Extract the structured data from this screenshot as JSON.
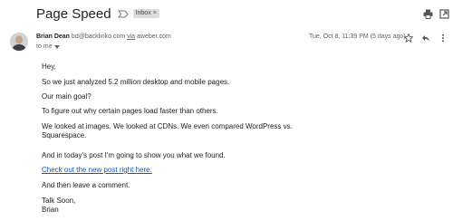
{
  "email": {
    "subject": "Page Speed",
    "label_chip": "Inbox",
    "chip_close": "×",
    "sender": {
      "name": "Brian Dean",
      "email": "bd@backlinko.com",
      "via_text": "via",
      "via_domain": "aweber.com",
      "to": "to me"
    },
    "date": "Tue, Oct 8, 11:39 PM (5 days ago)",
    "body": {
      "greeting": "Hey,",
      "p1": "So we just analyzed 5.2 million desktop and mobile pages.",
      "p2": "Our main goal?",
      "p3": "To figure out why certain pages load faster than others.",
      "p4_line1": "We looked at images. We looked at CDNs. We even compared WordPress vs.",
      "p4_line2": "Squarespace.",
      "p5": "And in today's post I'm going to show you what we found.",
      "link": "Check out the new post right here.",
      "p6": "And then leave a comment.",
      "signoff": "Talk Soon,",
      "signature": "Brian"
    }
  },
  "icons": {
    "important": "label-important-icon",
    "print": "print-icon",
    "new_window": "open-in-new-window-icon",
    "star": "star-icon",
    "reply": "reply-icon",
    "more": "more-vertical-icon",
    "dropdown": "arrow-drop-down-icon"
  },
  "colors": {
    "link": "#1155cc",
    "chip_bg": "#dddddd",
    "meta_text": "#5f6368"
  }
}
